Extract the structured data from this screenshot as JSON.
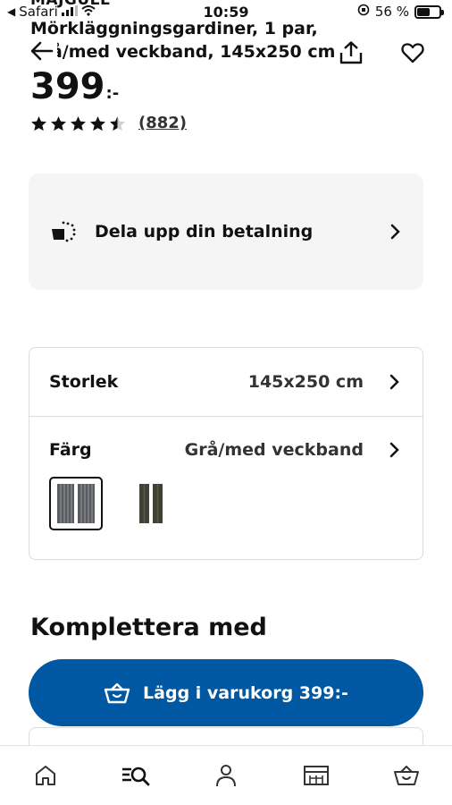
{
  "status_bar": {
    "back_app": "Safari",
    "time": "10:59",
    "battery": "56 %"
  },
  "product": {
    "brand": "MAJGULL",
    "name": "Mörkläggningsgardiner, 1 par, grå/med veckband, 145x250 cm",
    "price": "399",
    "currency_suffix": ":-",
    "rating_stars": 4.5,
    "reviews": "(882)"
  },
  "payment": {
    "label": "Dela upp din betalning"
  },
  "options": {
    "size": {
      "label": "Storlek",
      "value": "145x250 cm"
    },
    "color": {
      "label": "Färg",
      "value": "Grå/med veckband",
      "swatches": [
        {
          "name": "Grå/med veckband",
          "selected": true
        },
        {
          "name": "Mörkgrön",
          "selected": false
        }
      ]
    }
  },
  "section": {
    "complement_title": "Komplettera med"
  },
  "cart_button": {
    "label": "Lägg i varukorg 399:-"
  },
  "colors": {
    "accent": "#0058a3",
    "card_bg": "#f5f5f5",
    "border": "#dcdcdc"
  },
  "nav": [
    {
      "icon": "home-icon"
    },
    {
      "icon": "search-list-icon"
    },
    {
      "icon": "profile-icon"
    },
    {
      "icon": "store-icon"
    },
    {
      "icon": "basket-icon"
    }
  ]
}
